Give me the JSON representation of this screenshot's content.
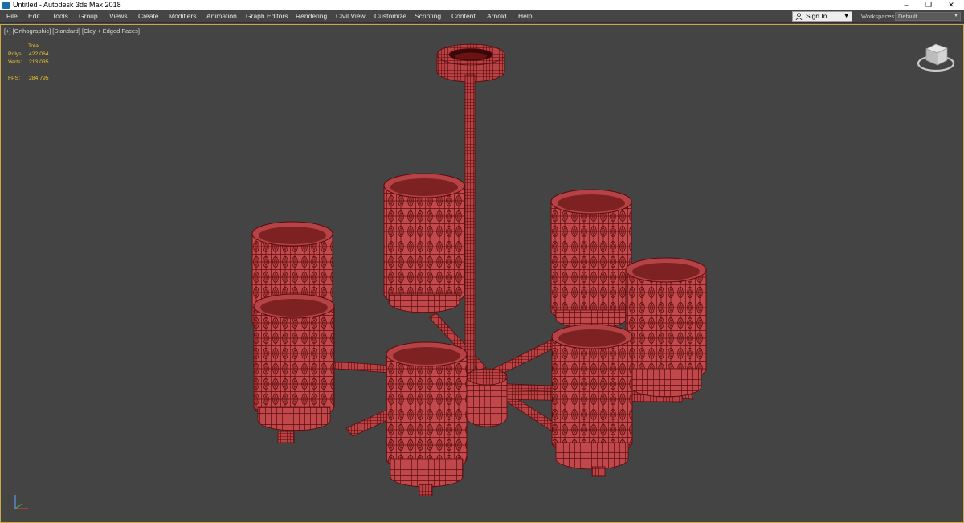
{
  "window": {
    "title": "Untitled - Autodesk 3ds Max 2018",
    "controls": {
      "minimize": "–",
      "restore": "❐",
      "close": "✕"
    }
  },
  "menu": [
    "File",
    "Edit",
    "Tools",
    "Group",
    "Views",
    "Create",
    "Modifiers",
    "Animation",
    "Graph Editors",
    "Rendering",
    "Civil View",
    "Customize",
    "Scripting",
    "Content",
    "Arnold",
    "Help"
  ],
  "signin": {
    "label": "Sign In",
    "icon": "user-icon"
  },
  "workspaces": {
    "label": "Workspaces:",
    "value": "Default"
  },
  "viewport": {
    "label_parts": [
      "[+]",
      "[Orthographic]",
      "[Standard]",
      "[Clay + Edged Faces]"
    ],
    "stats": {
      "header": "Total",
      "polys_label": "Polys:",
      "polys_value": "422 064",
      "verts_label": "Verts:",
      "verts_value": "213 035",
      "fps_label": "FPS:",
      "fps_value": "284,795"
    },
    "colors": {
      "stats": "#e8c930",
      "model": "#c0484a",
      "wire": "#5a0c0e",
      "background": "#444444",
      "active_border": "#c9a84a"
    }
  }
}
